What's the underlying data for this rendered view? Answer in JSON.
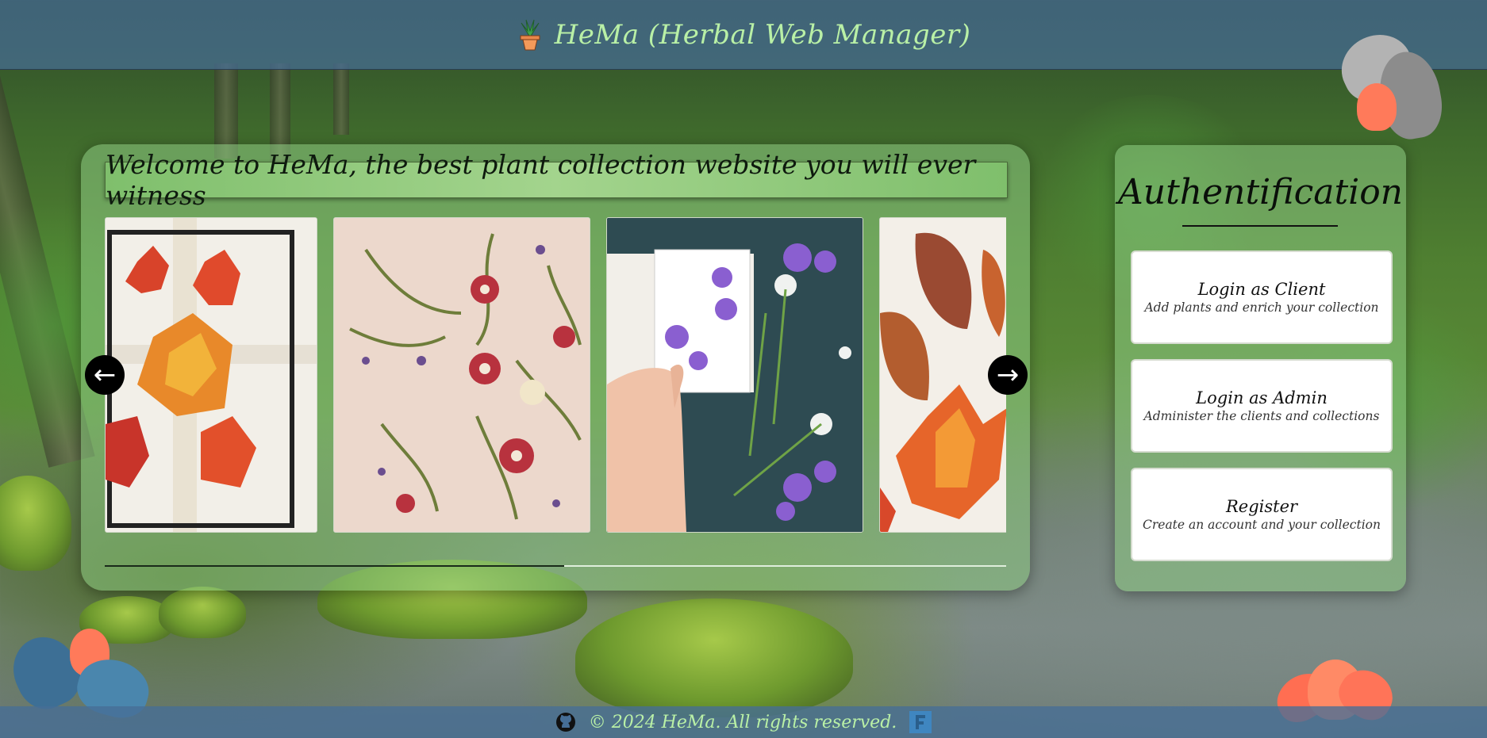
{
  "header": {
    "title": "HeMa (Herbal Web Manager)"
  },
  "carousel": {
    "heading": "Welcome to HeMa, the best plant collection website you will ever witness",
    "prev_label": "←",
    "next_label": "→",
    "progress": 0.51,
    "slides": [
      "pressed maple leaves in glass frame",
      "pressed wildflowers on pink background",
      "pressing violet flowers into a book",
      "pressed autumn leaves"
    ]
  },
  "auth": {
    "title": "Authentification",
    "buttons": [
      {
        "title": "Login as Client",
        "subtitle": "Add plants and enrich your collection"
      },
      {
        "title": "Login as Admin",
        "subtitle": "Administer the clients and collections"
      },
      {
        "title": "Register",
        "subtitle": "Create an account and your collection"
      }
    ]
  },
  "footer": {
    "copyright": "© 2024 HeMa. All rights reserved."
  },
  "colors": {
    "header_bg": "#466e96",
    "title_green": "#b9f0a6",
    "panel_green": "#8cc882",
    "flower_orange": "#ff7a5a",
    "flower_blue": "#3d7aa0"
  },
  "icons": [
    "potted-plant-icon",
    "github-icon",
    "figma-icon",
    "arrow-left-icon",
    "arrow-right-icon"
  ]
}
